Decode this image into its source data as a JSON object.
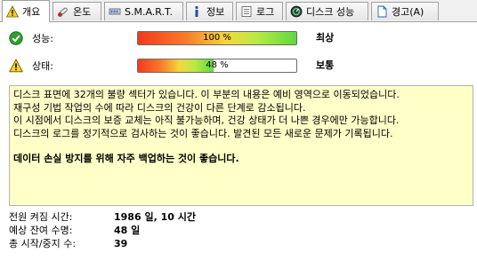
{
  "tabs": [
    {
      "label": "개요",
      "icon": "warning-icon",
      "active": true
    },
    {
      "label": "온도",
      "icon": "thermometer-icon",
      "active": false
    },
    {
      "label": "S.M.A.R.T.",
      "icon": "smart-icon",
      "active": false
    },
    {
      "label": "정보",
      "icon": "info-icon",
      "active": false
    },
    {
      "label": "로그",
      "icon": "log-icon",
      "active": false
    },
    {
      "label": "디스크 성능",
      "icon": "gauge-icon",
      "active": false
    },
    {
      "label": "경고(A)",
      "icon": "alert-page-icon",
      "active": false
    }
  ],
  "status": {
    "performance": {
      "label": "성능:",
      "value": "100 %",
      "percent": 100,
      "verdict": "최상",
      "icon": "check-icon"
    },
    "health": {
      "label": "상태:",
      "value": "48 %",
      "percent": 48,
      "verdict": "보통",
      "icon": "warning-icon"
    }
  },
  "info": {
    "lines": [
      "디스크 표면에 32개의 불량 섹터가 있습니다. 이 부분의 내용은 예비 영역으로 이동되었습니다.",
      "재구성 기법 작업의 수에 따라 디스크의 건강이 다른 단계로 감소됩니다.",
      "이 시점에서 디스크의 보증 교체는 아직 불가능하며, 건강 상태가 더 나쁜 경우에만 가능합니다.",
      "디스크의 로그를 정기적으로 검사하는 것이 좋습니다. 발견된 모든 새로운 문제가 기록됩니다."
    ],
    "warning": "데이터 손실 방지를 위해 자주 백업하는 것이 좋습니다."
  },
  "stats": [
    {
      "label": "전원 켜짐 시간:",
      "value": "1986 일, 10 시간"
    },
    {
      "label": "예상 잔여 수명:",
      "value": "48 일"
    },
    {
      "label": "총 시작/중지 수:",
      "value": "39"
    }
  ],
  "colors": {
    "info_bg": "#ffffc8",
    "ok_green": "#2e9e2e",
    "warn_yellow": "#f5d31a"
  }
}
